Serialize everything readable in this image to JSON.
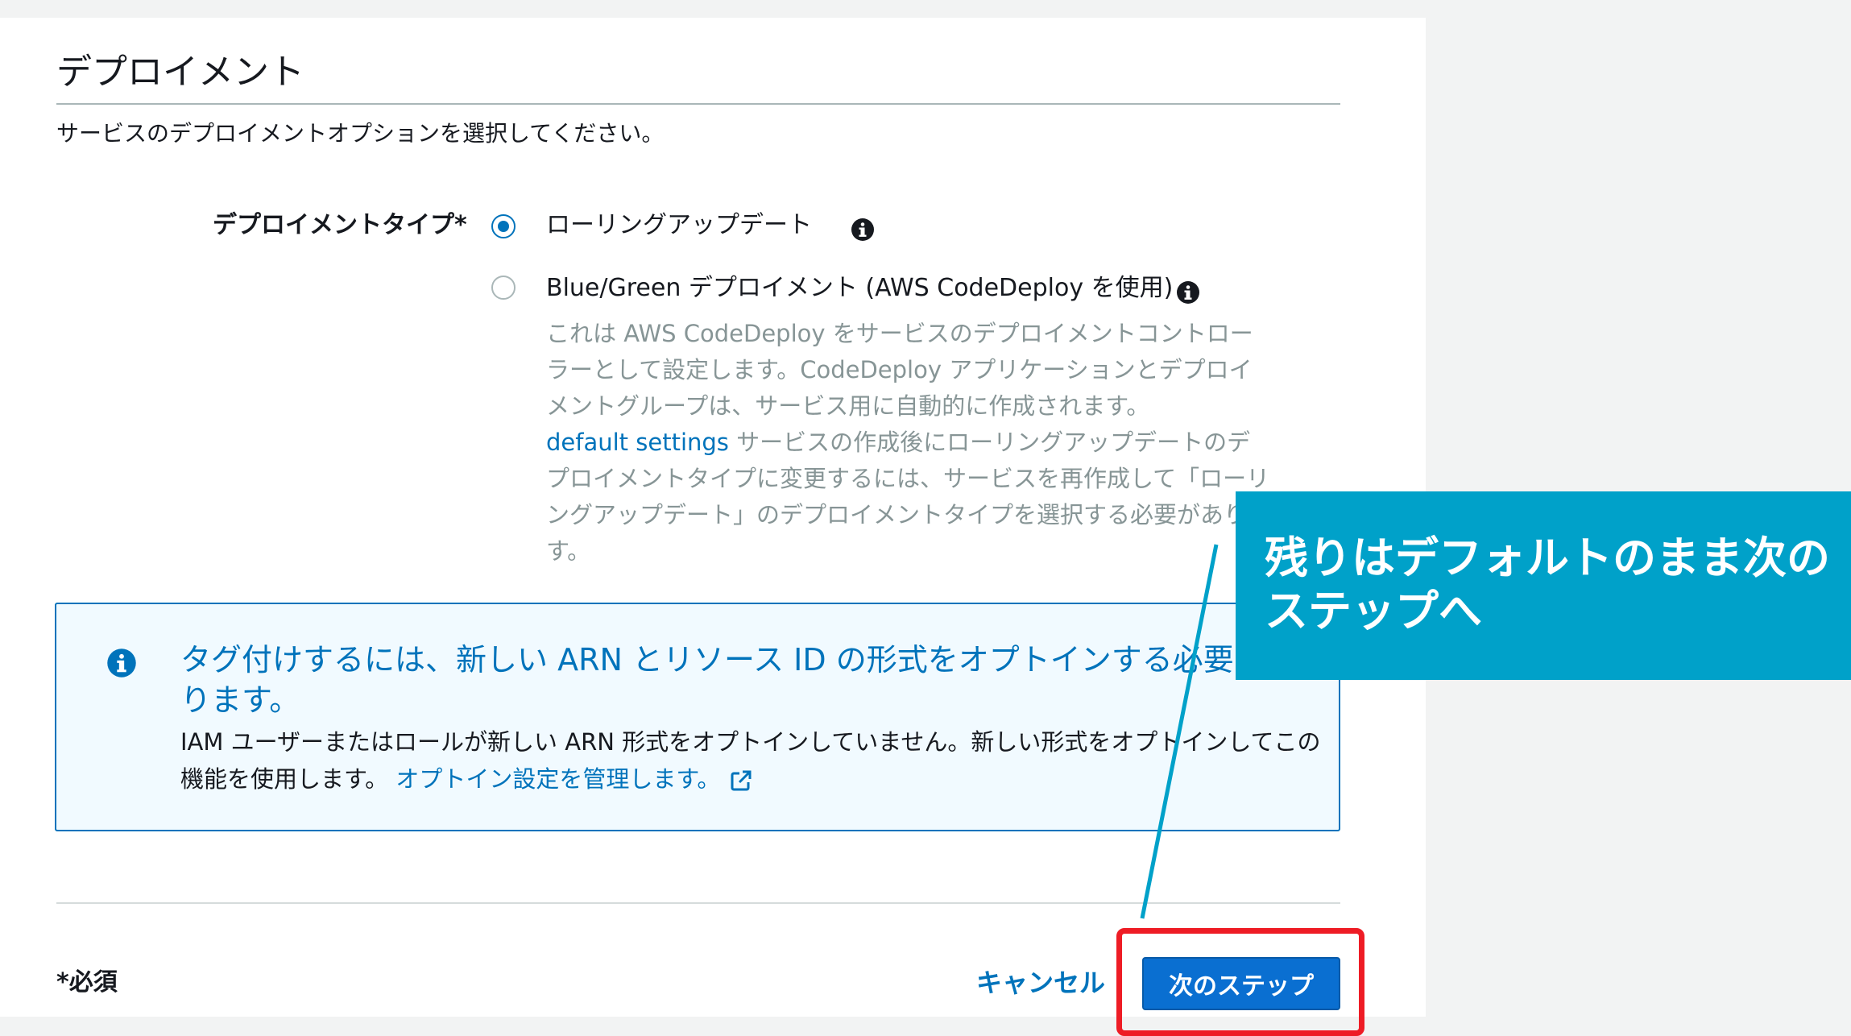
{
  "section": {
    "title": "デプロイメント",
    "description": "サービスのデプロイメントオプションを選択してください。"
  },
  "deployment_type": {
    "label": "デプロイメントタイプ*",
    "options": [
      {
        "label": "ローリングアップデート",
        "selected": true
      },
      {
        "label": "Blue/Green デプロイメント (AWS CodeDeploy を使用)",
        "selected": false
      }
    ],
    "bluegreen_description_1": "これは AWS CodeDeploy をサービスのデプロイメントコントローラーとして設定します。CodeDeploy アプリケーションとデプロイメントグループは、サービス用に自動的に作成されます。",
    "bluegreen_link": "default settings",
    "bluegreen_description_2": " サービスの作成後にローリングアップデートのデプロイメントタイプに変更するには、サービスを再作成して「ローリングアップデート」のデプロイメントタイプを選択する必要があります。"
  },
  "alert": {
    "heading": "タグ付けするには、新しい ARN とリソース ID の形式をオプトインする必要があります。",
    "body": "IAM ユーザーまたはロールが新しい ARN 形式をオプトインしていません。新しい形式をオプトインしてこの機能を使用します。",
    "link": "オプトイン設定を管理します。"
  },
  "footer": {
    "required_note": "*必須",
    "cancel_label": "キャンセル",
    "next_label": "次のステップ"
  },
  "callout": {
    "text": "残りはデフォルトのまま次のステップへ"
  },
  "colors": {
    "accent": "#0073bb",
    "primary_button": "#0a6fd1",
    "callout": "#00a1c9",
    "highlight": "#ee1c25"
  },
  "icons": {
    "info": "info-icon",
    "external_link": "external-link-icon"
  }
}
